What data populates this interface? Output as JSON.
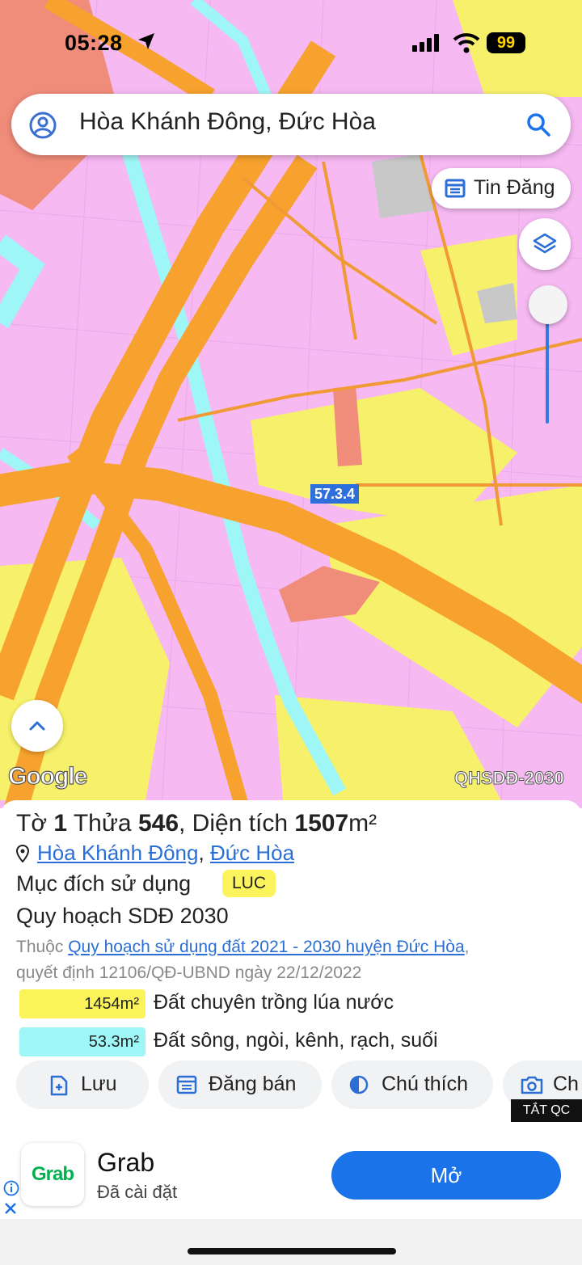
{
  "status_bar": {
    "time": "05:28",
    "battery": "99"
  },
  "search": {
    "query": "Hòa Khánh Đông, Đức Hòa"
  },
  "map": {
    "tin_dang_label": "Tin Đăng",
    "parcel_label": "57.3.4",
    "google_logo": "Google",
    "map_code": "QHSDĐ-2030"
  },
  "panel": {
    "title": {
      "to_label": "Tờ",
      "to": "1",
      "thua_label": "Thửa",
      "thua": "546",
      "area_label": ", Diện tích",
      "area": "1507",
      "unit": "m²"
    },
    "location": {
      "commune": "Hòa Khánh Đông",
      "separator": ",",
      "district": "Đức Hòa"
    },
    "purpose_label": "Mục đích sử dụng",
    "purpose_code": "LUC",
    "plan_title": "Quy hoạch SDĐ 2030",
    "desc_prefix": "Thuộc",
    "desc_link": "Quy hoạch sử dụng đất 2021 - 2030 huyện Đức Hòa",
    "desc_suffix": ",",
    "desc_line2": "quyết định 12106/QĐ-UBND ngày 22/12/2022",
    "usages": [
      {
        "area": "1454m²",
        "label": "Đất chuyên trồng lúa nước",
        "color": "#fbf35a"
      },
      {
        "area": "53.3m²",
        "label": "Đất sông, ngòi, kênh, rạch, suối",
        "color": "#9ff6f6"
      }
    ],
    "actions": [
      {
        "label": "Lưu",
        "icon": "save-add-icon"
      },
      {
        "label": "Đăng bán",
        "icon": "list-calendar-icon"
      },
      {
        "label": "Chú thích",
        "icon": "contrast-icon"
      },
      {
        "label": "Ch",
        "icon": "camera-icon"
      }
    ],
    "close_ad": "TẮT QC"
  },
  "ad": {
    "logo_text": "Grab",
    "name": "Grab",
    "subtitle": "Đã cài đặt",
    "cta": "Mở"
  },
  "colors": {
    "pink": "#f6b8f2",
    "orange": "#f7a12e",
    "yellow": "#f8f169",
    "cyan": "#9ff6f6",
    "salmon": "#f08c7a",
    "accent": "#1a73e8"
  }
}
